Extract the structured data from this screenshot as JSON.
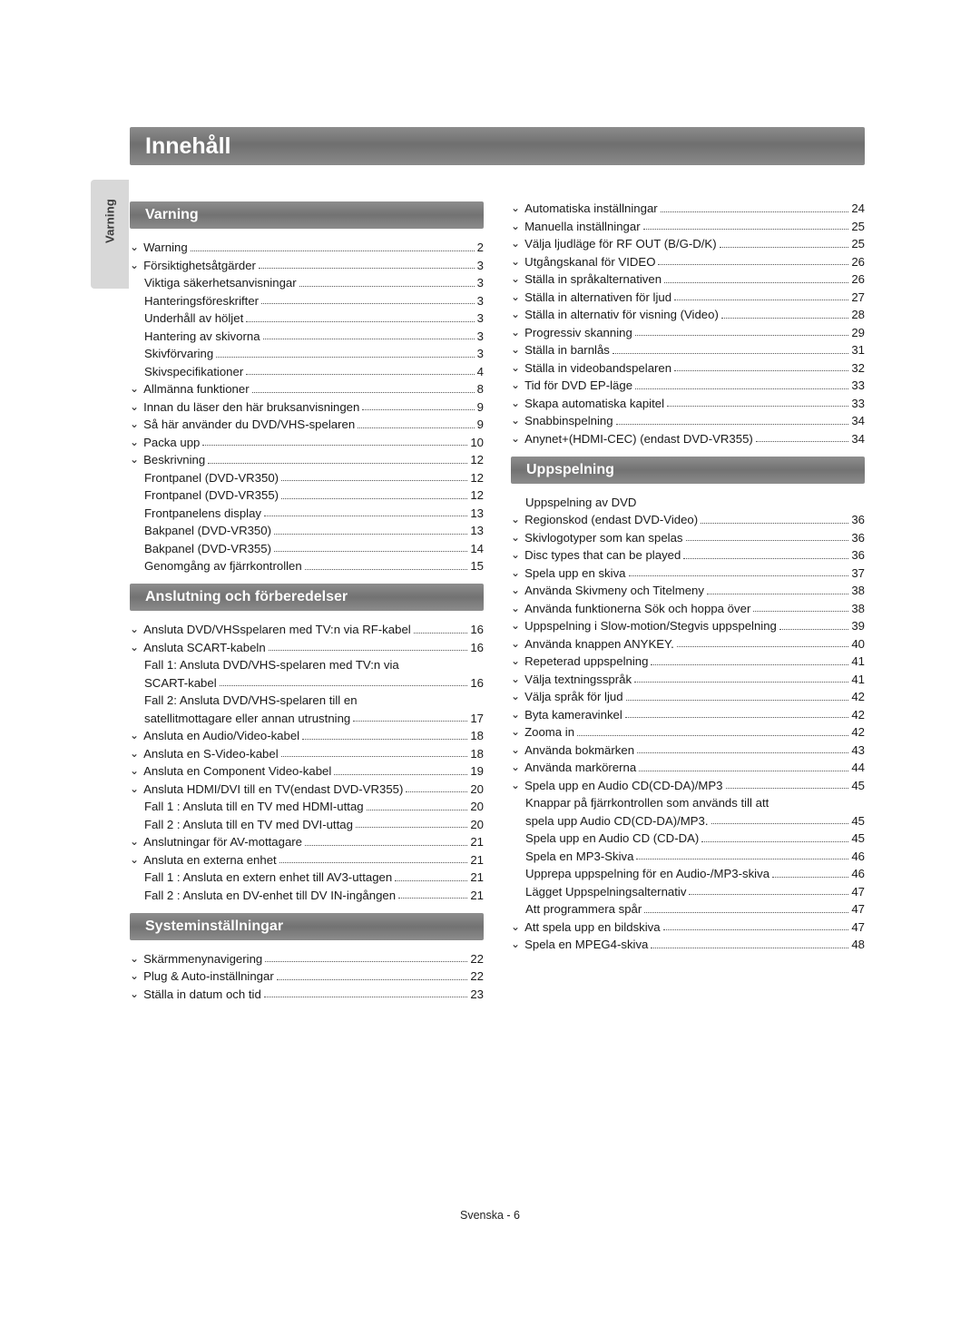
{
  "page": {
    "title": "Innehåll",
    "side_tab_label": "Varning",
    "footer": "Svenska - 6"
  },
  "sections": {
    "varning": {
      "header": "Varning",
      "entries": [
        {
          "bullet": true,
          "label": "Warning",
          "page": "2"
        },
        {
          "bullet": true,
          "label": "Försiktighetsåtgärder",
          "page": "3"
        },
        {
          "bullet": false,
          "label": "Viktiga säkerhetsanvisningar",
          "page": "3"
        },
        {
          "bullet": false,
          "label": "Hanteringsföreskrifter",
          "page": "3"
        },
        {
          "bullet": false,
          "label": "Underhåll av höljet",
          "page": "3"
        },
        {
          "bullet": false,
          "label": "Hantering av skivorna",
          "page": "3"
        },
        {
          "bullet": false,
          "label": "Skivförvaring",
          "page": "3"
        },
        {
          "bullet": false,
          "label": "Skivspecifikationer",
          "page": "4"
        },
        {
          "bullet": true,
          "label": "Allmänna funktioner",
          "page": "8"
        },
        {
          "bullet": true,
          "label": "Innan du läser den här bruksanvisningen",
          "page": "9"
        },
        {
          "bullet": true,
          "label": "Så här använder du DVD/VHS-spelaren",
          "page": "9"
        },
        {
          "bullet": true,
          "label": "Packa upp",
          "page": "10"
        },
        {
          "bullet": true,
          "label": "Beskrivning",
          "page": "12"
        },
        {
          "bullet": false,
          "label": "Frontpanel (DVD-VR350)",
          "page": "12"
        },
        {
          "bullet": false,
          "label": "Frontpanel (DVD-VR355)",
          "page": "12"
        },
        {
          "bullet": false,
          "label": "Frontpanelens display",
          "page": "13"
        },
        {
          "bullet": false,
          "label": "Bakpanel (DVD-VR350)",
          "page": "13"
        },
        {
          "bullet": false,
          "label": "Bakpanel (DVD-VR355)",
          "page": "14"
        },
        {
          "bullet": false,
          "label": "Genomgång av fjärrkontrollen",
          "page": "15"
        }
      ]
    },
    "anslutning": {
      "header": "Anslutning och förberedelser",
      "entries": [
        {
          "bullet": true,
          "label": "Ansluta DVD/VHSspelaren med TV:n via RF-kabel",
          "page": "16"
        },
        {
          "bullet": true,
          "label": "Ansluta SCART-kabeln",
          "page": "16"
        },
        {
          "bullet": false,
          "wrap_first": "Fall 1: Ansluta DVD/VHS-spelaren med TV:n via",
          "label": "SCART-kabel",
          "page": "16"
        },
        {
          "bullet": false,
          "wrap_first": "Fall 2: Ansluta DVD/VHS-spelaren till en",
          "label": "satellitmottagare eller annan utrustning",
          "page": "17"
        },
        {
          "bullet": true,
          "label": "Ansluta en Audio/Video-kabel",
          "page": "18"
        },
        {
          "bullet": true,
          "label": "Ansluta en S-Video-kabel",
          "page": "18"
        },
        {
          "bullet": true,
          "label": "Ansluta en Component Video-kabel",
          "page": "19"
        },
        {
          "bullet": true,
          "label": "Ansluta HDMI/DVI till en TV(endast DVD-VR355)",
          "page": "20"
        },
        {
          "bullet": false,
          "label": "Fall 1 : Ansluta till en TV med HDMI-uttag",
          "page": "20"
        },
        {
          "bullet": false,
          "label": "Fall 2 : Ansluta till en TV med DVI-uttag",
          "page": "20"
        },
        {
          "bullet": true,
          "label": "Anslutningar för AV-mottagare",
          "page": "21"
        },
        {
          "bullet": true,
          "label": "Ansluta en externa enhet",
          "page": "21"
        },
        {
          "bullet": false,
          "label": "Fall 1 : Ansluta en extern enhet till AV3-uttagen",
          "page": "21"
        },
        {
          "bullet": false,
          "label": "Fall 2 : Ansluta en DV-enhet till DV IN-ingången",
          "page": "21"
        }
      ]
    },
    "systeminstallningar": {
      "header": "Systeminställningar",
      "entries": [
        {
          "bullet": true,
          "label": "Skärmmenynavigering",
          "page": "22"
        },
        {
          "bullet": true,
          "label": "Plug & Auto-inställningar",
          "page": "22"
        },
        {
          "bullet": true,
          "label": "Ställa in datum och tid",
          "page": "23"
        }
      ]
    },
    "right_top": {
      "entries": [
        {
          "bullet": true,
          "label": "Automatiska inställningar",
          "page": "24"
        },
        {
          "bullet": true,
          "label": "Manuella inställningar",
          "page": "25"
        },
        {
          "bullet": true,
          "label": "Välja ljudläge för RF OUT (B/G-D/K)",
          "page": "25"
        },
        {
          "bullet": true,
          "label": "Utgångskanal för VIDEO",
          "page": "26"
        },
        {
          "bullet": true,
          "label": "Ställa in språkalternativen",
          "page": "26"
        },
        {
          "bullet": true,
          "label": "Ställa in alternativen för ljud",
          "page": "27"
        },
        {
          "bullet": true,
          "label": "Ställa in alternativ för visning (Video)",
          "page": "28"
        },
        {
          "bullet": true,
          "label": "Progressiv skanning",
          "page": "29"
        },
        {
          "bullet": true,
          "label": "Ställa in barnlås",
          "page": "31"
        },
        {
          "bullet": true,
          "label": "Ställa in videobandspelaren",
          "page": "32"
        },
        {
          "bullet": true,
          "label": "Tid för DVD EP-läge",
          "page": "33"
        },
        {
          "bullet": true,
          "label": "Skapa automatiska kapitel",
          "page": "33"
        },
        {
          "bullet": true,
          "label": "Snabbinspelning",
          "page": "34"
        },
        {
          "bullet": true,
          "label": "Anynet+(HDMI-CEC) (endast DVD-VR355)",
          "page": "34"
        }
      ]
    },
    "uppspelning": {
      "header": "Uppspelning",
      "entries": [
        {
          "bullet": false,
          "label": "Uppspelning av DVD",
          "page": ""
        },
        {
          "bullet": true,
          "label": "Regionskod (endast DVD-Video)",
          "page": "36"
        },
        {
          "bullet": true,
          "label": "Skivlogotyper som kan spelas",
          "page": "36"
        },
        {
          "bullet": true,
          "label": "Disc types that can be played",
          "page": "36"
        },
        {
          "bullet": true,
          "label": "Spela upp en skiva",
          "page": "37"
        },
        {
          "bullet": true,
          "label": "Använda Skivmeny och Titelmeny",
          "page": "38"
        },
        {
          "bullet": true,
          "label": "Använda funktionerna Sök och hoppa över",
          "page": "38"
        },
        {
          "bullet": true,
          "label": "Uppspelning i Slow-motion/Stegvis uppspelning",
          "page": "39"
        },
        {
          "bullet": true,
          "label": "Använda knappen ANYKEY.",
          "page": "40"
        },
        {
          "bullet": true,
          "label": "Repeterad uppspelning",
          "page": "41"
        },
        {
          "bullet": true,
          "label": "Välja textningsspråk",
          "page": "41"
        },
        {
          "bullet": true,
          "label": "Välja språk för ljud",
          "page": "42"
        },
        {
          "bullet": true,
          "label": "Byta kameravinkel",
          "page": "42"
        },
        {
          "bullet": true,
          "label": "Zooma in",
          "page": "42"
        },
        {
          "bullet": true,
          "label": "Använda bokmärken",
          "page": "43"
        },
        {
          "bullet": true,
          "label": "Använda markörerna",
          "page": "44"
        },
        {
          "bullet": true,
          "label": "Spela upp en Audio CD(CD-DA)/MP3",
          "page": "45"
        },
        {
          "bullet": false,
          "wrap_first": "Knappar på fjärrkontrollen som används till att",
          "label": "spela upp Audio CD(CD-DA)/MP3.",
          "page": "45"
        },
        {
          "bullet": false,
          "label": "Spela upp en Audio CD (CD-DA)",
          "page": "45"
        },
        {
          "bullet": false,
          "label": "Spela en MP3-Skiva",
          "page": "46"
        },
        {
          "bullet": false,
          "label": "Upprepa uppspelning för en Audio-/MP3-skiva",
          "page": "46"
        },
        {
          "bullet": false,
          "label": "Lägget Uppspelningsalternativ",
          "page": "47"
        },
        {
          "bullet": false,
          "label": "Att programmera spår",
          "page": "47"
        },
        {
          "bullet": true,
          "label": "Att spela upp en bildskiva",
          "page": "47"
        },
        {
          "bullet": true,
          "label": "Spela en MPEG4-skiva",
          "page": "48"
        }
      ]
    }
  }
}
